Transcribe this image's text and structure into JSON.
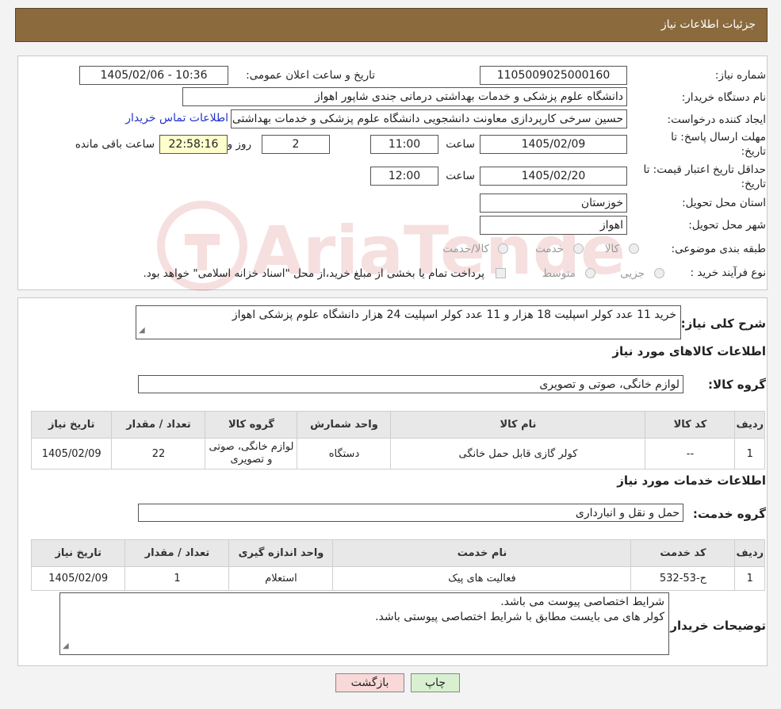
{
  "header": {
    "title": "جزئیات اطلاعات نیاز"
  },
  "watermark": {
    "text": "AriaTender.neT"
  },
  "fields": {
    "need_number_label": "شماره نیاز:",
    "need_number": "1105009025000160",
    "announce_label": "تاریخ و ساعت اعلان عمومی:",
    "announce_value": "1405/02/06 - 10:36",
    "buyer_label": "نام دستگاه خریدار:",
    "buyer_value": "دانشگاه علوم پزشکی و خدمات بهداشتی درمانی جندی شاپور اهواز",
    "creator_label": "ایجاد کننده درخواست:",
    "creator_value": "حسین سرخی کارپردازی معاونت دانشجویی دانشگاه علوم پزشکی و خدمات بهداشتی",
    "contact_link": "اطلاعات تماس خریدار",
    "reply_label_1": "مهلت ارسال پاسخ: تا",
    "reply_label_2": "تاریخ:",
    "reply_date": "1405/02/09",
    "time_label": "ساعت",
    "reply_time": "11:00",
    "days_value": "2",
    "days_label": "روز و",
    "remaining_time": "22:58:16",
    "remaining_label": "ساعت باقی مانده",
    "price_label_1": "حداقل تاریخ اعتبار قیمت: تا",
    "price_label_2": "تاریخ:",
    "price_date": "1405/02/20",
    "price_time": "12:00",
    "province_label": "استان محل تحویل:",
    "province_value": "خوزستان",
    "city_label": "شهر محل تحویل:",
    "city_value": "اهواز",
    "category_label": "طبقه بندی موضوعی:",
    "category_options": [
      "کالا",
      "خدمت",
      "کالا/خدمت"
    ],
    "process_label": "نوع فرآیند خرید :",
    "process_options": [
      "جزیی",
      "متوسط"
    ],
    "process_note": "پرداخت تمام یا بخشی از مبلغ خرید،از محل \"اسناد خزانه اسلامی\" خواهد بود."
  },
  "description": {
    "label": "شرح کلی نیاز:",
    "value": "خرید 11 عدد کولر اسپلیت 18 هزار و 11 عدد کولر اسپلیت 24 هزار دانشگاه علوم پزشکی اهواز"
  },
  "goods": {
    "section_title": "اطلاعات کالاهای مورد نیاز",
    "group_label": "گروه کالا:",
    "group_value": "لوازم خانگی، صوتی و تصویری",
    "columns": [
      "ردیف",
      "کد کالا",
      "نام کالا",
      "واحد شمارش",
      "گروه کالا",
      "تعداد / مقدار",
      "تاریخ نیاز"
    ],
    "rows": [
      [
        "1",
        "--",
        "کولر گازی قابل حمل خانگی",
        "دستگاه",
        "لوازم خانگی، صوتی و تصویری",
        "22",
        "1405/02/09"
      ]
    ]
  },
  "services": {
    "section_title": "اطلاعات خدمات مورد نیاز",
    "group_label": "گروه خدمت:",
    "group_value": "حمل و نقل و انبارداری",
    "columns": [
      "ردیف",
      "کد خدمت",
      "نام خدمت",
      "واحد اندازه گیری",
      "تعداد / مقدار",
      "تاریخ نیاز"
    ],
    "rows": [
      [
        "1",
        "ح-53-532",
        "فعالیت های پیک",
        "استعلام",
        "1",
        "1405/02/09"
      ]
    ]
  },
  "buyer_notes": {
    "label": "توضیحات خریدار:",
    "line1": "شرایط اختصاصی پیوست می باشد.",
    "line2": "کولر های می بایست مطابق با شرایط اختصاصی پیوستی باشد."
  },
  "buttons": {
    "print": "چاپ",
    "back": "بازگشت"
  },
  "colors": {
    "header_bg": "#8b6a3e",
    "timer_bg": "#ffffcc",
    "link": "#2233cc",
    "back_btn": "#f8d8d8",
    "print_btn": "#d8f0d0"
  }
}
